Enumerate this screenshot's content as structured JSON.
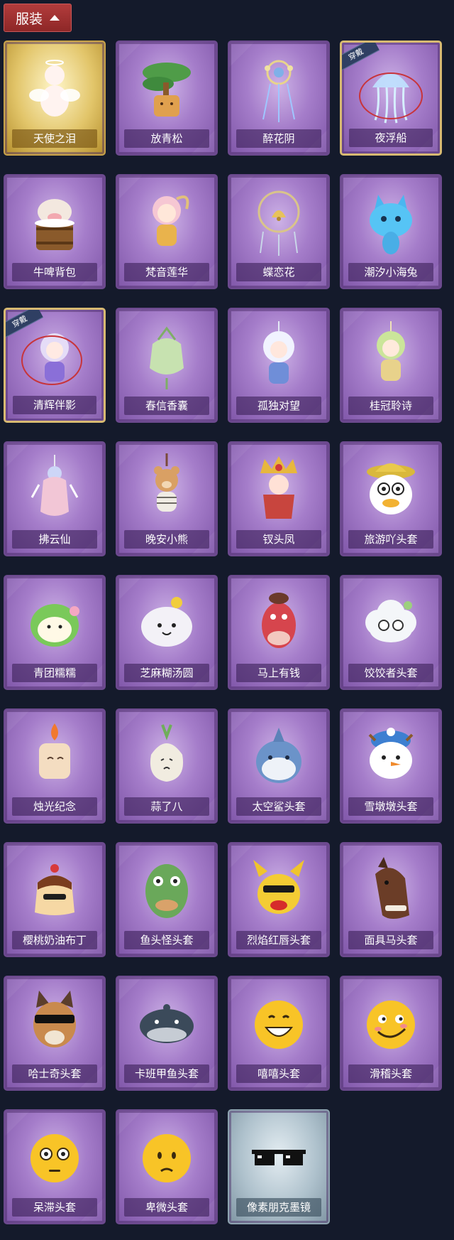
{
  "header": {
    "title": "服装"
  },
  "items": [
    {
      "name": "天使之泪",
      "frame": "gold",
      "icon": "angel-figure-icon",
      "worn": false
    },
    {
      "name": "放青松",
      "frame": "purple",
      "icon": "bonsai-pine-icon",
      "worn": false
    },
    {
      "name": "醉花阴",
      "frame": "purple",
      "icon": "floral-charm-icon",
      "worn": false
    },
    {
      "name": "夜浮船",
      "frame": "purple",
      "icon": "jellyfish-lantern-icon",
      "worn": true,
      "badge": "穿戴"
    },
    {
      "name": "牛啤背包",
      "frame": "purple",
      "icon": "cow-barrel-icon",
      "worn": false
    },
    {
      "name": "梵音莲华",
      "frame": "purple",
      "icon": "chibi-doll-icon",
      "worn": false
    },
    {
      "name": "蝶恋花",
      "frame": "purple",
      "icon": "bell-charm-icon",
      "worn": false
    },
    {
      "name": "潮汐小海兔",
      "frame": "purple",
      "icon": "blue-bunny-icon",
      "worn": false
    },
    {
      "name": "清辉伴影",
      "frame": "purple",
      "icon": "moon-doll-icon",
      "worn": true,
      "badge": "穿戴"
    },
    {
      "name": "春信香囊",
      "frame": "purple",
      "icon": "sachet-icon",
      "worn": false
    },
    {
      "name": "孤独对望",
      "frame": "purple",
      "icon": "white-hair-doll-icon",
      "worn": false
    },
    {
      "name": "桂冠聆诗",
      "frame": "purple",
      "icon": "laurel-doll-icon",
      "worn": false
    },
    {
      "name": "拂云仙",
      "frame": "purple",
      "icon": "fairy-charm-icon",
      "worn": false
    },
    {
      "name": "晚安小熊",
      "frame": "purple",
      "icon": "bear-charm-icon",
      "worn": false
    },
    {
      "name": "钗头凤",
      "frame": "purple",
      "icon": "phoenix-crown-icon",
      "worn": false
    },
    {
      "name": "旅游吖头套",
      "frame": "purple",
      "icon": "duck-hat-icon",
      "worn": false
    },
    {
      "name": "青团糯糯",
      "frame": "purple",
      "icon": "green-mochi-icon",
      "worn": false
    },
    {
      "name": "芝麻糊汤圆",
      "frame": "purple",
      "icon": "white-mochi-icon",
      "worn": false
    },
    {
      "name": "马上有钱",
      "frame": "purple",
      "icon": "red-horse-icon",
      "worn": false
    },
    {
      "name": "饺饺者头套",
      "frame": "purple",
      "icon": "cloud-dumpling-icon",
      "worn": false
    },
    {
      "name": "烛光纪念",
      "frame": "purple",
      "icon": "candle-icon",
      "worn": false
    },
    {
      "name": "蒜了八",
      "frame": "purple",
      "icon": "garlic-icon",
      "worn": false
    },
    {
      "name": "太空鲨头套",
      "frame": "purple",
      "icon": "shark-head-icon",
      "worn": false
    },
    {
      "name": "雪墩墩头套",
      "frame": "purple",
      "icon": "snowman-head-icon",
      "worn": false
    },
    {
      "name": "樱桃奶油布丁",
      "frame": "purple",
      "icon": "pudding-icon",
      "worn": false
    },
    {
      "name": "鱼头怪头套",
      "frame": "purple",
      "icon": "fish-head-icon",
      "worn": false
    },
    {
      "name": "烈焰红唇头套",
      "frame": "purple",
      "icon": "yellow-mouse-head-icon",
      "worn": false
    },
    {
      "name": "面具马头套",
      "frame": "purple",
      "icon": "horse-mask-icon",
      "worn": false
    },
    {
      "name": "哈士奇头套",
      "frame": "purple",
      "icon": "husky-head-icon",
      "worn": false
    },
    {
      "name": "卡班甲鱼头套",
      "frame": "purple",
      "icon": "seal-head-icon",
      "worn": false
    },
    {
      "name": "嘻嘻头套",
      "frame": "purple",
      "icon": "grin-emoji-icon",
      "worn": false
    },
    {
      "name": "滑稽头套",
      "frame": "purple",
      "icon": "funny-emoji-icon",
      "worn": false
    },
    {
      "name": "呆滞头套",
      "frame": "purple",
      "icon": "dazed-emoji-icon",
      "worn": false
    },
    {
      "name": "卑微头套",
      "frame": "purple",
      "icon": "humble-emoji-icon",
      "worn": false
    },
    {
      "name": "像素朋克墨镜",
      "frame": "silver",
      "icon": "pixel-sunglasses-icon",
      "worn": false
    }
  ]
}
